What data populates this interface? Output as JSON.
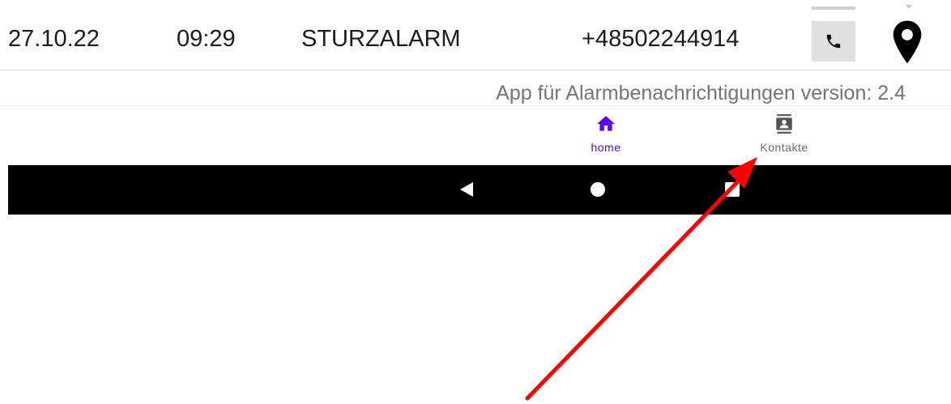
{
  "alarm": {
    "date": "27.10.22",
    "time": "09:29",
    "type": "STURZALARM",
    "phone": "+48502244914",
    "call_icon": "phone-icon",
    "location_icon": "location-pin-icon"
  },
  "footer": {
    "version_text": "App für Alarmbenachrichtigungen version: 2.4"
  },
  "bottom_nav": {
    "items": [
      {
        "label": "home",
        "icon": "home-icon",
        "active": true
      },
      {
        "label": "Kontakte",
        "icon": "contacts-icon",
        "active": false
      }
    ]
  },
  "system_nav": {
    "buttons": [
      "back-icon",
      "home-circle-icon",
      "recents-icon"
    ]
  },
  "colors": {
    "accent": "#6200ee",
    "annotation_arrow": "#ff0000",
    "system_bar": "#000000"
  }
}
